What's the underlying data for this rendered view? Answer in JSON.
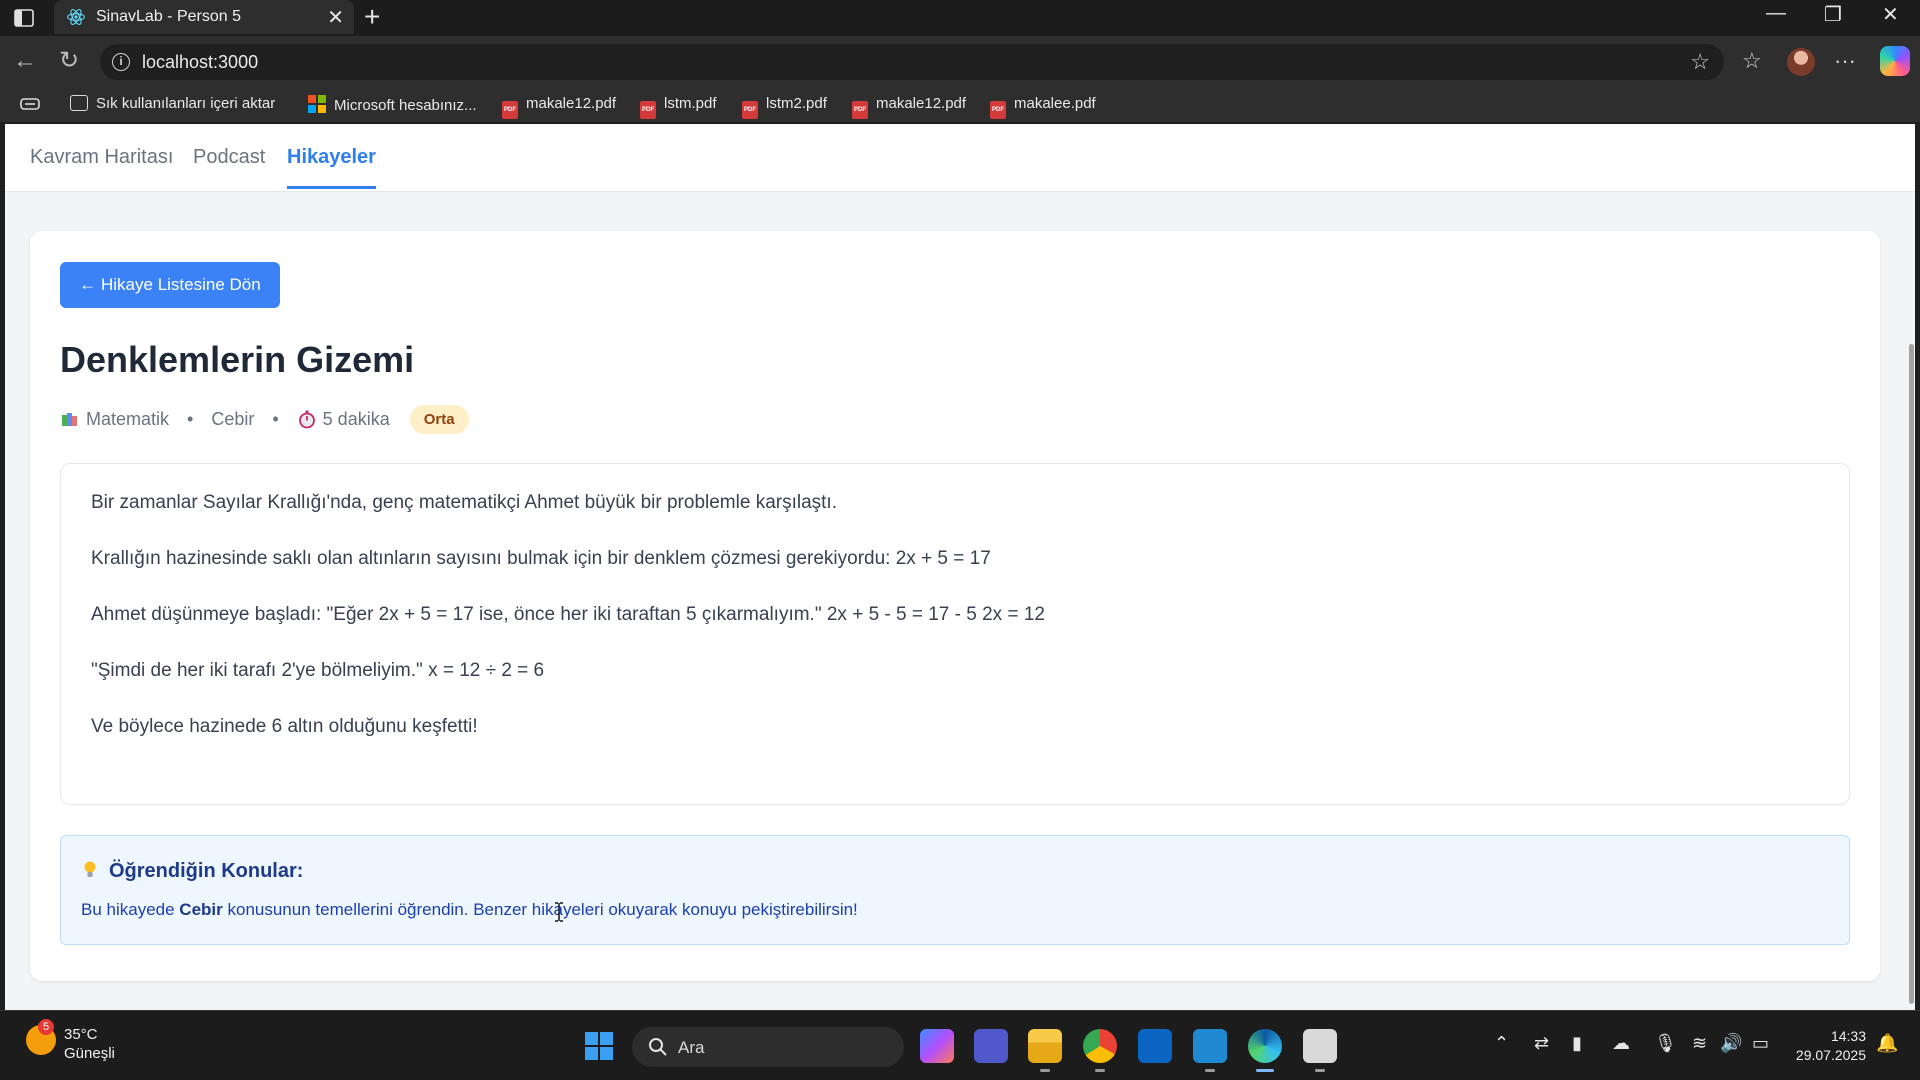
{
  "browser": {
    "tab_title": "SinavLab - Person 5",
    "url": "localhost:3000",
    "bookmarks": [
      "Sık kullanılanları içeri aktar",
      "Microsoft hesabınız...",
      "makale12.pdf",
      "lstm.pdf",
      "lstm2.pdf",
      "makale12.pdf",
      "makalee.pdf"
    ]
  },
  "app_nav": {
    "tabs": [
      "Kavram Haritası",
      "Podcast",
      "Hikayeler"
    ],
    "active_tab": "Hikayeler"
  },
  "story": {
    "back_label": "← Hikaye Listesine Dön",
    "title": "Denklemlerin Gizemi",
    "subject": "Matematik",
    "topic": "Cebir",
    "duration": "5 dakika",
    "difficulty": "Orta",
    "paragraphs": [
      "Bir zamanlar Sayılar Krallığı'nda, genç matematikçi Ahmet büyük bir problemle karşılaştı.",
      "Krallığın hazinesinde saklı olan altınların sayısını bulmak için bir denklem çözmesi gerekiyordu: 2x + 5 = 17",
      "Ahmet düşünmeye başladı: \"Eğer 2x + 5 = 17 ise, önce her iki taraftan 5 çıkarmalıyım.\" 2x + 5 - 5 = 17 - 5 2x = 12",
      "\"Şimdi de her iki tarafı 2'ye bölmeliyim.\" x = 12 ÷ 2 = 6",
      "Ve böylece hazinede 6 altın olduğunu keşfetti!"
    ]
  },
  "learned": {
    "heading": "Öğrendiğin Konular:",
    "text_before": "Bu hikayede ",
    "topic_bold": "Cebir",
    "text_after": " konusunun temellerini öğrendin. Benzer hikayeleri okuyarak konuyu pekiştirebilirsin!"
  },
  "taskbar": {
    "weather_temp": "35°C",
    "weather_desc": "Güneşli",
    "weather_badge": "5",
    "search_label": "Ara",
    "time": "14:33",
    "date": "29.07.2025"
  },
  "colors": {
    "accent": "#2f80ed",
    "button": "#3b82f6",
    "badge_bg": "#fdefc7",
    "learn_bg": "#eef6ff"
  }
}
